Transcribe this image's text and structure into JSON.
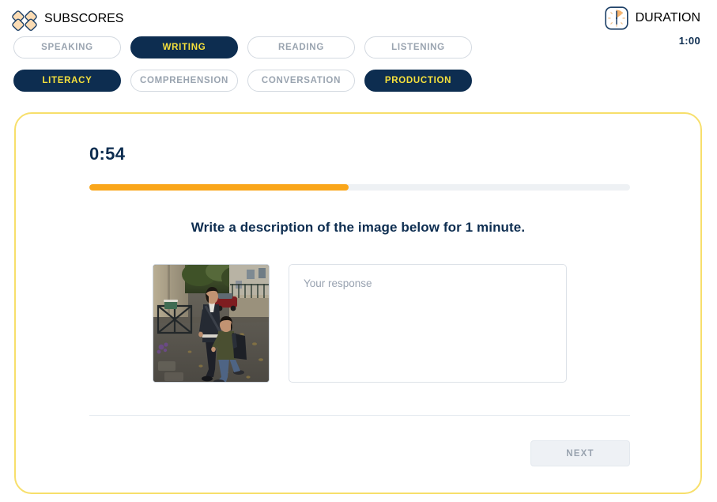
{
  "header": {
    "logo_icon": "four-diamonds-icon",
    "title": "SUBSCORES",
    "duration": {
      "icon": "clock-icon",
      "label": "DURATION",
      "value": "1:00"
    }
  },
  "subscore_tabs": {
    "row1": [
      {
        "label": "SPEAKING",
        "active": false
      },
      {
        "label": "WRITING",
        "active": true
      },
      {
        "label": "READING",
        "active": false
      },
      {
        "label": "LISTENING",
        "active": false
      }
    ],
    "row2": [
      {
        "label": "LITERACY",
        "active": true
      },
      {
        "label": "COMPREHENSION",
        "active": false
      },
      {
        "label": "CONVERSATION",
        "active": false
      },
      {
        "label": "PRODUCTION",
        "active": true
      }
    ]
  },
  "task_card": {
    "timer": "0:54",
    "progress_percent": 48,
    "prompt": "Write a description of the image below for 1 minute.",
    "stimulus_image_alt": "A man in a dark jacket and a boy with a backpack walking together on a paved street",
    "response": {
      "value": "",
      "placeholder": "Your response"
    },
    "next_button": {
      "label": "NEXT",
      "disabled": true
    }
  },
  "colors": {
    "navy": "#0d2d50",
    "yellow_text": "#f5e03c",
    "card_border": "#f7df6b",
    "progress_fill": "#faa61a",
    "progress_track": "#eef1f4",
    "inactive_text": "#9aa4b0"
  }
}
